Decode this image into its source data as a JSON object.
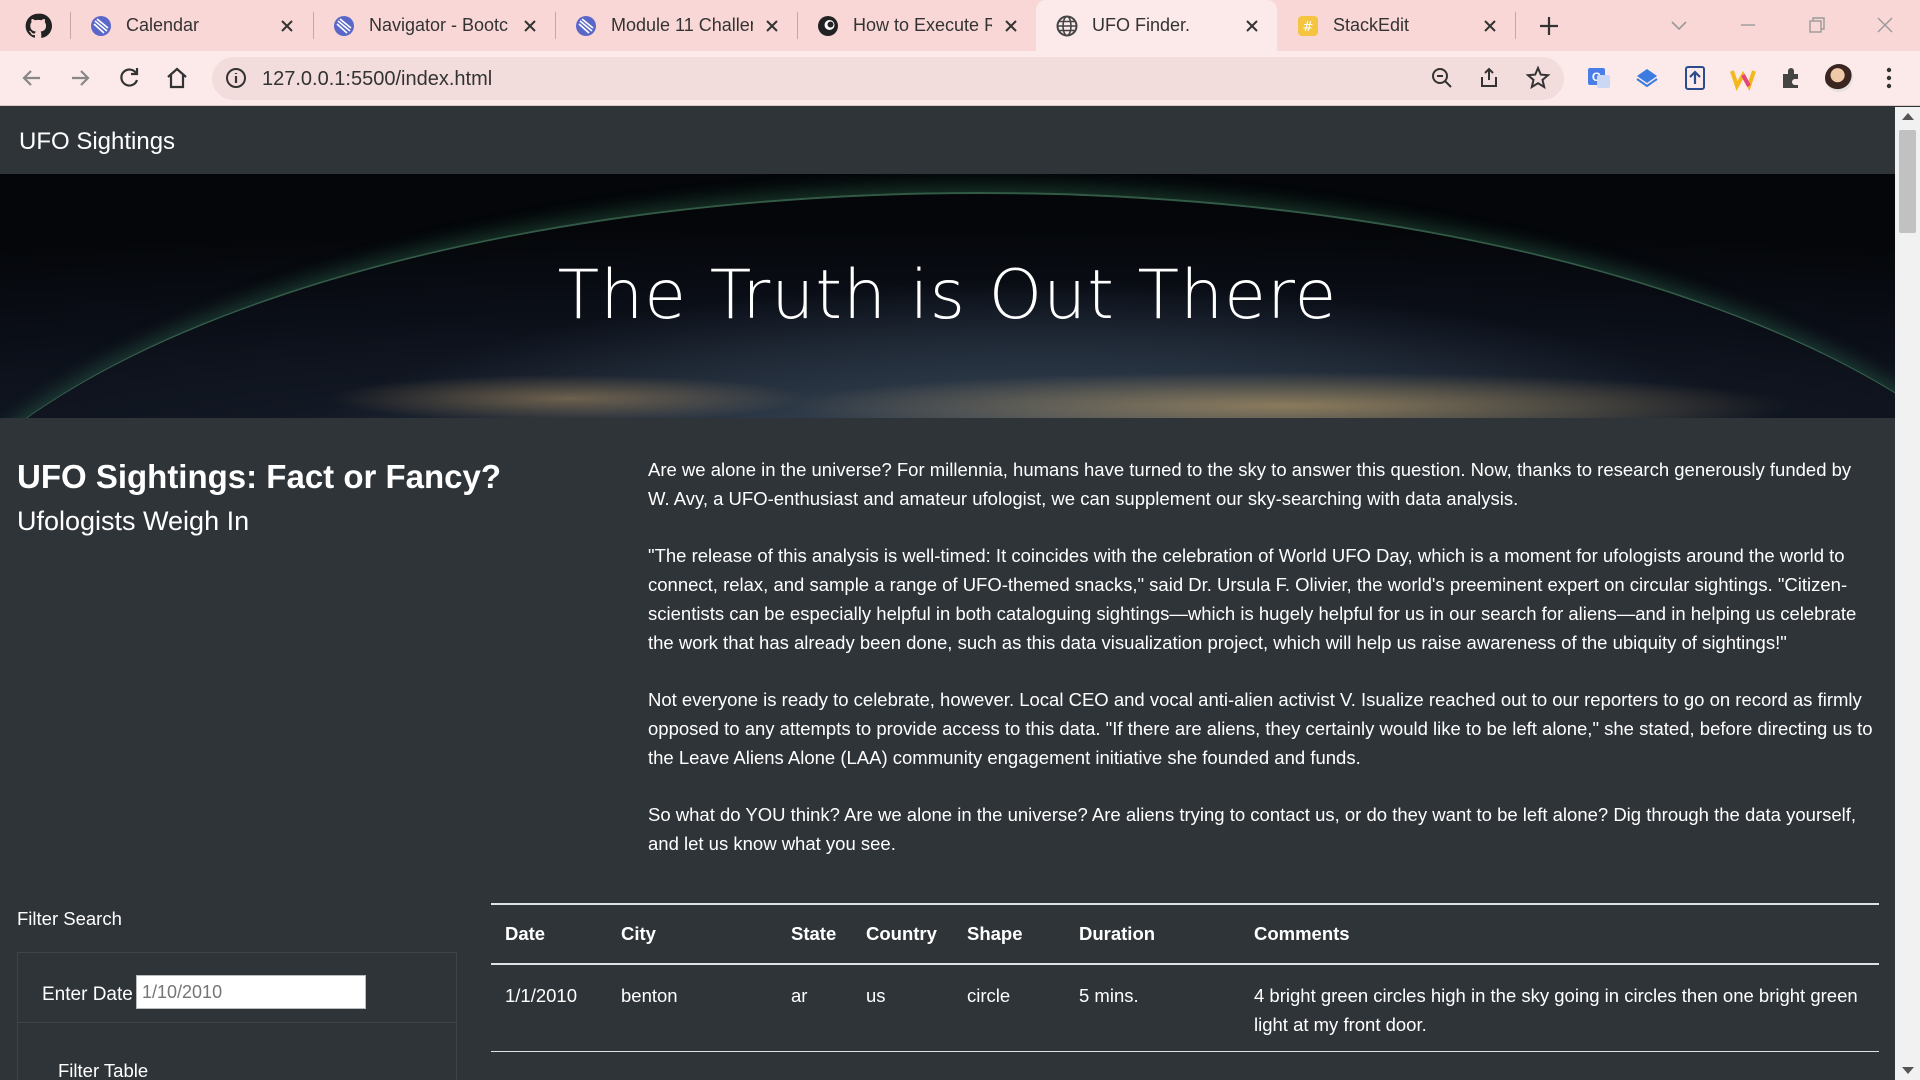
{
  "browser": {
    "tabs": [
      {
        "title": "Calendar",
        "icon": "bootcamp-globe-icon",
        "active": false
      },
      {
        "title": "Navigator - Bootc",
        "icon": "bootcamp-globe-icon",
        "active": false
      },
      {
        "title": "Module 11 Challer",
        "icon": "bootcamp-globe-icon",
        "active": false
      },
      {
        "title": "How to Execute R",
        "icon": "site-favicon",
        "active": false
      },
      {
        "title": "UFO Finder.",
        "icon": "globe-icon",
        "active": true
      },
      {
        "title": "StackEdit",
        "icon": "stackedit-icon",
        "active": false
      }
    ],
    "url": "127.0.0.1:5500/index.html"
  },
  "page": {
    "brand": "UFO Sightings",
    "hero_title": "The Truth is Out There",
    "heading": {
      "title": "UFO Sightings: Fact or Fancy?",
      "subtitle": "Ufologists Weigh In"
    },
    "paragraphs": [
      "Are we alone in the universe? For millennia, humans have turned to the sky to answer this question. Now, thanks to research generously funded by W. Avy, a UFO-enthusiast and amateur ufologist, we can supplement our sky-searching with data analysis.",
      "\"The release of this analysis is well-timed: It coincides with the celebration of World UFO Day, which is a moment for ufologists around the world to connect, relax, and sample a range of UFO-themed snacks,\" said Dr. Ursula F. Olivier, the world's preeminent expert on circular sightings. \"Citizen-scientists can be especially helpful in both cataloguing sightings—which is hugely helpful for us in our search for aliens—and in helping us celebrate the work that has already been done, such as this data visualization project, which will help us raise awareness of the ubiquity of sightings!\"",
      "Not everyone is ready to celebrate, however. Local CEO and vocal anti-alien activist V. Isualize reached out to our reporters to go on record as firmly opposed to any attempts to provide access to this data. \"If there are aliens, they certainly would like to be left alone,\" she stated, before directing us to the Leave Aliens Alone (LAA) community engagement initiative she founded and funds.",
      "So what do YOU think? Are we alone in the universe? Are aliens trying to contact us, or do they want to be left alone? Dig through the data yourself, and let us know what you see."
    ],
    "filter": {
      "title": "Filter Search",
      "date_label": "Enter Date",
      "date_placeholder": "1/10/2010",
      "button_label": "Filter Table"
    },
    "table": {
      "headers": [
        "Date",
        "City",
        "State",
        "Country",
        "Shape",
        "Duration",
        "Comments"
      ],
      "rows": [
        [
          "1/1/2010",
          "benton",
          "ar",
          "us",
          "circle",
          "5 mins.",
          "4 bright green circles high in the sky going in circles then one bright green light at my front door."
        ]
      ]
    }
  }
}
